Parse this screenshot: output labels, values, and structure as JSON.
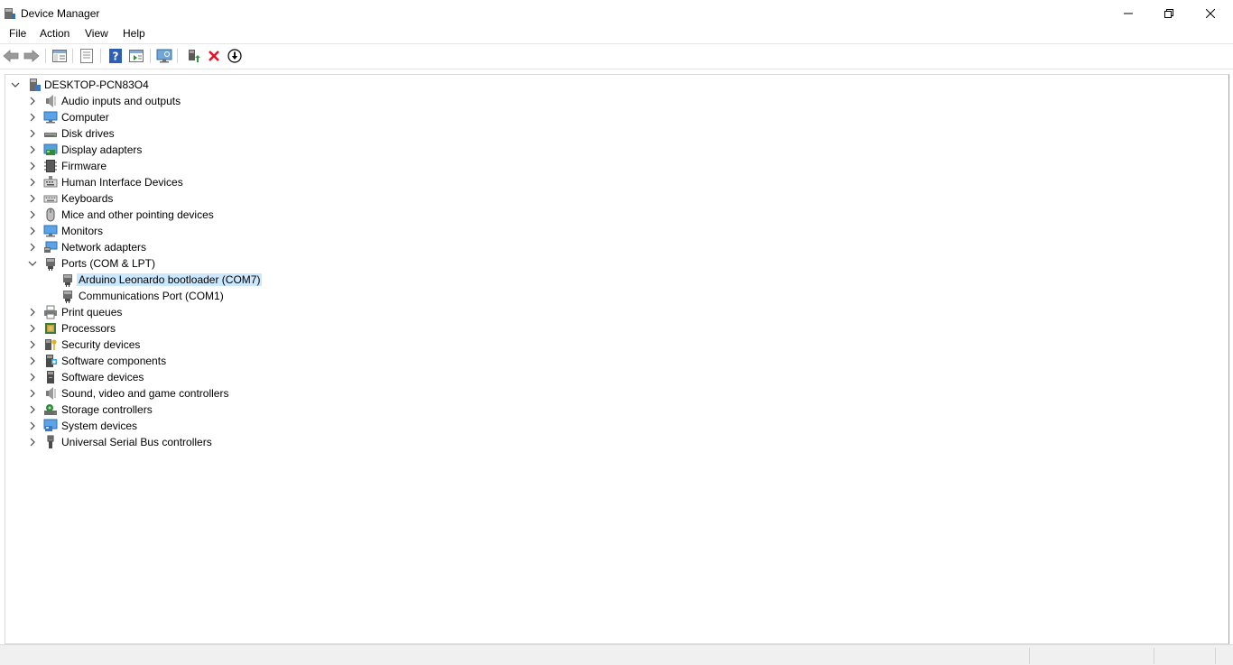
{
  "window": {
    "title": "Device Manager"
  },
  "menu": [
    "File",
    "Action",
    "View",
    "Help"
  ],
  "tree": {
    "root": "DESKTOP-PCN83O4",
    "categories": [
      {
        "label": "Audio inputs and outputs",
        "icon": "speaker-icon",
        "expanded": false
      },
      {
        "label": "Computer",
        "icon": "computer-icon",
        "expanded": false
      },
      {
        "label": "Disk drives",
        "icon": "disk-drive-icon",
        "expanded": false
      },
      {
        "label": "Display adapters",
        "icon": "display-adapter-icon",
        "expanded": false
      },
      {
        "label": "Firmware",
        "icon": "firmware-icon",
        "expanded": false
      },
      {
        "label": "Human Interface Devices",
        "icon": "hid-icon",
        "expanded": false
      },
      {
        "label": "Keyboards",
        "icon": "keyboard-icon",
        "expanded": false
      },
      {
        "label": "Mice and other pointing devices",
        "icon": "mouse-icon",
        "expanded": false
      },
      {
        "label": "Monitors",
        "icon": "monitor-icon",
        "expanded": false
      },
      {
        "label": "Network adapters",
        "icon": "network-adapter-icon",
        "expanded": false
      },
      {
        "label": "Ports (COM & LPT)",
        "icon": "port-icon",
        "expanded": true,
        "children": [
          {
            "label": "Arduino Leonardo bootloader (COM7)",
            "icon": "port-icon",
            "selected": true
          },
          {
            "label": "Communications Port (COM1)",
            "icon": "port-icon",
            "selected": false
          }
        ]
      },
      {
        "label": "Print queues",
        "icon": "printer-icon",
        "expanded": false
      },
      {
        "label": "Processors",
        "icon": "processor-icon",
        "expanded": false
      },
      {
        "label": "Security devices",
        "icon": "security-device-icon",
        "expanded": false
      },
      {
        "label": "Software components",
        "icon": "software-component-icon",
        "expanded": false
      },
      {
        "label": "Software devices",
        "icon": "software-device-icon",
        "expanded": false
      },
      {
        "label": "Sound, video and game controllers",
        "icon": "speaker-icon",
        "expanded": false
      },
      {
        "label": "Storage controllers",
        "icon": "storage-controller-icon",
        "expanded": false
      },
      {
        "label": "System devices",
        "icon": "system-device-icon",
        "expanded": false
      },
      {
        "label": "Universal Serial Bus controllers",
        "icon": "usb-icon",
        "expanded": false
      }
    ]
  },
  "colors": {
    "selection": "#cce8ff",
    "accent": "#0078d7",
    "uninstall": "#e81123"
  }
}
